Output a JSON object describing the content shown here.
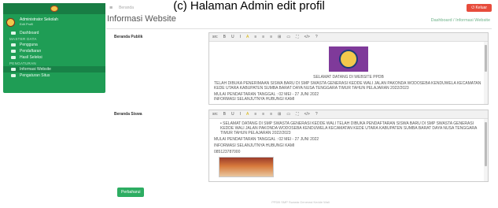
{
  "caption": "(c) Halaman Admin edit profil",
  "sidebar": {
    "user": "Administrator Sekolah",
    "user_sub": "Edit Profil",
    "items": [
      {
        "label": "Dashboard",
        "type": "item"
      },
      {
        "label": "MASTER DATA",
        "type": "header"
      },
      {
        "label": "Pengguna",
        "type": "item"
      },
      {
        "label": "Pendaftaran",
        "type": "item"
      },
      {
        "label": "Hasil Seleksi",
        "type": "item"
      },
      {
        "label": "PENGATURAN",
        "type": "header"
      },
      {
        "label": "Informasi Website",
        "type": "item",
        "active": true
      },
      {
        "label": "Pengaturan Situs",
        "type": "item"
      }
    ]
  },
  "topbar": {
    "brand": "Beranda",
    "logout": "Keluar"
  },
  "page": {
    "title": "Informasi Website",
    "breadcrumb": "Dashboard / Informasi Website"
  },
  "fields": {
    "beranda_publik": {
      "label": "Beranda Publik",
      "welcome": "SELAMAT DATANG DI WEBSITE PPDB",
      "paragraph": "TELAH DIBUKA PENERIMAAN SISWA BARU DI SMP SWASTA GENERASI KEDDE WALI JALAN PAKONDA WODOSEBA KENDUWELA KECAMATAN KEDE UTARA KABUPATEN SUMBA BARAT DAYA NUSA TENGGARA TIMUR TAHUN PELAJARAN 2022/2023",
      "schedule": "MULAI PENDAFTARAN TANGGAL : 02 MEI - 27 JUNI 2022",
      "info": "INFORMASI SELANJUTNYA HUBUNGI KAMI"
    },
    "beranda_siswa": {
      "label": "Beranda Siswa",
      "bullet": "SELAMAT DATANG DI SMP SWASTA GENERASI KEDDE WALI TELAH DIBUKA PENDAFTARAN SISWA BARU DI SMP SWASTA GENERASI KEDDE WALI JALAN PAKONDA WODOSEBA KENDUWELA KECAMATAN KEDE UTARA KABUPATEN SUMBA BARAT DAYA NUSA TENGGARA TIMUR TAHUN PELAJARAN 2022/2023",
      "schedule": "MULAI PENDAFTARAN TANGGAL : 02 MEI - 27 JUNI 2022",
      "info": "INFORMASI SELANJUTNYA HUBUNGI KAMI",
      "phone": "085123787000"
    }
  },
  "toolbar": [
    "src",
    "B",
    "U",
    "I",
    "A",
    "≡",
    "≡",
    "≡",
    "⊞",
    "▭",
    "⛶",
    "</>",
    "?"
  ],
  "buttons": {
    "submit": "Perbaharui"
  },
  "footer": "PPDB SMP Swasta Generasi Kedde Wali"
}
